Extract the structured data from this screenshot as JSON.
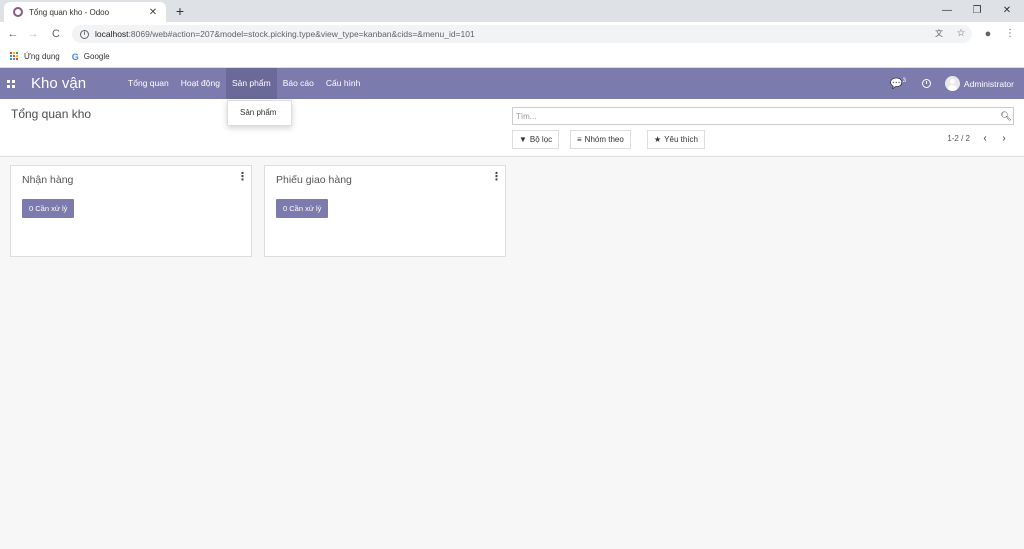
{
  "browser": {
    "tab_title": "Tổng quan kho - Odoo",
    "tab_close": "✕",
    "new_tab": "+",
    "window_controls": [
      "—",
      "❐",
      "✕"
    ],
    "nav": {
      "back": "←",
      "forward": "→",
      "reload": "C"
    },
    "url_host": "localhost",
    "url_rest": ":8069/web#action=207&model=stock.picking.type&view_type=kanban&cids=&menu_id=101",
    "bookmarks": [
      {
        "label": "Ứng dụng",
        "icon": "apps-grid-icon"
      },
      {
        "label": "Google",
        "icon": "google-icon"
      }
    ]
  },
  "navbar": {
    "brand": "Kho vận",
    "menu": [
      {
        "label": "Tổng quan"
      },
      {
        "label": "Hoạt động"
      },
      {
        "label": "Sản phẩm",
        "active": true
      },
      {
        "label": "Báo cáo"
      },
      {
        "label": "Cấu hình"
      }
    ],
    "chat_count": "3",
    "user": "Administrator",
    "color": "#7c7bad"
  },
  "dropdown": {
    "items": [
      "Sản phẩm"
    ]
  },
  "control_panel": {
    "breadcrumb": "Tổng quan kho",
    "search_placeholder": "Tìm...",
    "filters_label": "Bộ lọc",
    "group_by_label": "Nhóm theo",
    "favorites_label": "Yêu thích",
    "pager": "1-2 / 2"
  },
  "kanban": {
    "cards": [
      {
        "title": "Nhận hàng",
        "button": "0 Cần xử lý"
      },
      {
        "title": "Phiếu giao hàng",
        "button": "0 Cần xử lý"
      }
    ]
  }
}
